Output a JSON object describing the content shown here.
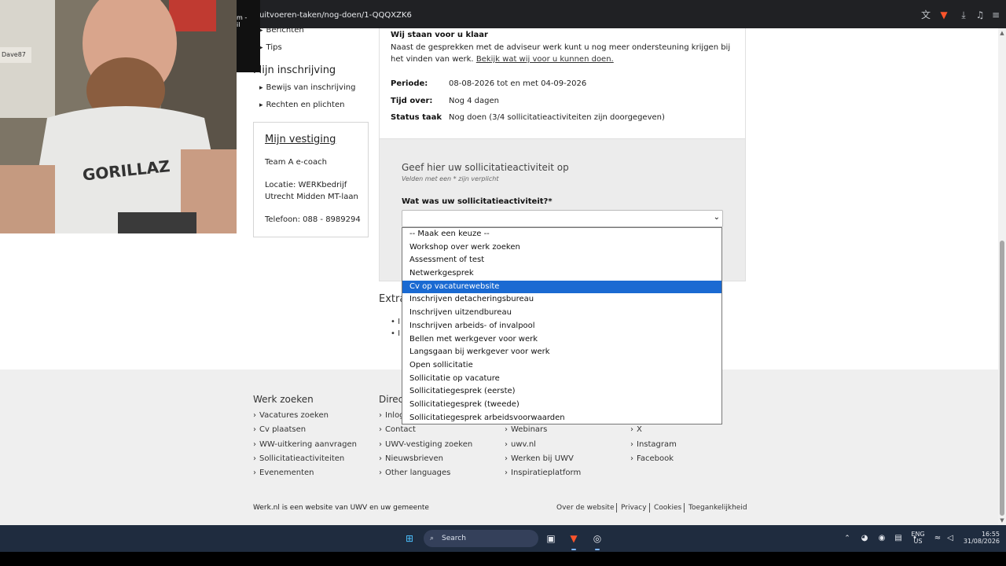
{
  "browser": {
    "url": "uitvoeren-taken/nog-doen/1-QQQXZK6",
    "cam_tab_label": "m -\nil"
  },
  "leftnav": {
    "links_top": [
      "Berichten",
      "Tips"
    ],
    "section_title": "Mijn inschrijving",
    "section_links": [
      "Bewijs van inschrijving",
      "Rechten en plichten"
    ]
  },
  "vestiging": {
    "title": "Mijn vestiging",
    "team": "Team A e-coach",
    "location_label": "Locatie: WERKbedrijf",
    "location_line2": "Utrecht Midden MT-laan",
    "phone": "Telefoon: 088 - 8989294"
  },
  "info": {
    "title": "Wij staan voor u klaar",
    "text": "Naast de gesprekken met de adviseur werk kunt u nog meer ondersteuning krijgen bij het vinden van werk.",
    "link": "Bekijk wat wij voor u kunnen doen.",
    "periode_label": "Periode:",
    "periode_value": "08-08-2026 tot en met 04-09-2026",
    "tijd_label": "Tijd over:",
    "tijd_value": "Nog 4 dagen",
    "status_label": "Status taak",
    "status_value": "Nog doen   (3/4 sollicitatieactiviteiten zijn doorgegeven)"
  },
  "form": {
    "title": "Geef hier uw sollicitatieactiviteit op",
    "subtitle": "Velden met een * zijn verplicht",
    "field_label": "Wat was uw sollicitatieactiviteit?*",
    "options": [
      "-- Maak een keuze --",
      "Workshop over werk zoeken",
      "Assessment of test",
      "Netwerkgesprek",
      "Cv op vacaturewebsite",
      "Inschrijven detacheringsbureau",
      "Inschrijven uitzendbureau",
      "Inschrijven arbeids- of invalpool",
      "Bellen met werkgever voor werk",
      "Langsgaan bij werkgever voor werk",
      "Open sollicitatie",
      "Sollicitatie op vacature",
      "Sollicitatiegesprek (eerste)",
      "Sollicitatiegesprek (tweede)",
      "Sollicitatiegesprek arbeidsvoorwaarden"
    ],
    "highlighted_index": 4
  },
  "extra": {
    "heading": "Extra",
    "bullets": [
      "I",
      "I"
    ]
  },
  "footer": {
    "col1_title": "Werk zoeken",
    "col1_links": [
      "Vacatures zoeken",
      "Cv plaatsen",
      "WW-uitkering aanvragen",
      "Sollicitatieactiviteiten",
      "Evenementen"
    ],
    "col2_title": "Direct",
    "col2_links": [
      "Inlog",
      "Contact",
      "UWV-vestiging zoeken",
      "Nieuwsbrieven",
      "Other languages"
    ],
    "col3_links": [
      "Webinars",
      "uwv.nl",
      "Werken bij UWV",
      "Inspiratieplatform"
    ],
    "col4_links": [
      "X",
      "Instagram",
      "Facebook"
    ],
    "bottom_text": "Werk.nl is een website van UWV en uw gemeente",
    "bottom_links": [
      "Over de website",
      "Privacy",
      "Cookies",
      "Toegankelijkheid"
    ]
  },
  "taskbar": {
    "search_label": "Search",
    "lang_line1": "ENG",
    "lang_line2": "US",
    "time": "16:55",
    "date": "31/08/2026"
  },
  "webcam": {
    "shirt_text": "GORILLAZ",
    "sticker_text": "Dave87"
  },
  "colors": {
    "highlight": "#1a6ad2",
    "taskbar": "#1f2c3f",
    "footer_bg": "#efefef",
    "form_bg": "#ececec"
  }
}
